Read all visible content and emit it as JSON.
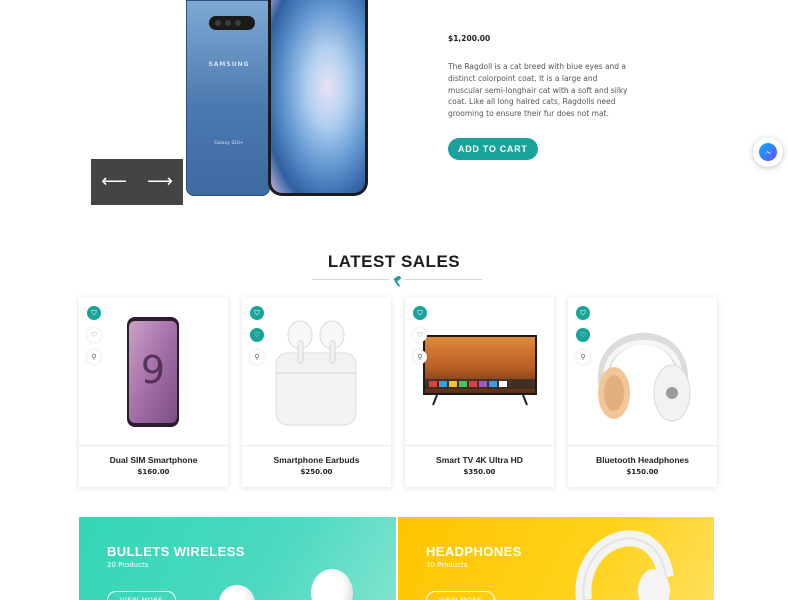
{
  "hero": {
    "price": "$1,200.00",
    "description": "The Ragdoll is a cat breed with blue eyes and a distinct colorpoint coat. It is a large and muscular semi-longhair cat with a soft and silky coat. Like all long haired cats, Ragdolls need grooming to ensure their fur does not mat.",
    "add_to_cart": "ADD TO CART",
    "phone_brand": "SAMSUNG",
    "phone_model": "Galaxy S10+",
    "prev_arrow": "⟵",
    "next_arrow": "⟶"
  },
  "section": {
    "title": "LATEST SALES"
  },
  "products": [
    {
      "name": "Dual SIM Smartphone",
      "price": "$160.00"
    },
    {
      "name": "Smartphone Earbuds",
      "price": "$250.00"
    },
    {
      "name": "Smart TV 4K Ultra HD",
      "price": "$350.00"
    },
    {
      "name": "Bluetooth Headphones",
      "price": "$150.00"
    }
  ],
  "card_actions": {
    "cart_icon": "⛉",
    "heart_icon": "♡",
    "search_icon": "⚲"
  },
  "banners": [
    {
      "title": "BULLETS WIRELESS",
      "subtitle": "20 Products",
      "button": "VIEW MORE"
    },
    {
      "title": "HEADPHONES",
      "subtitle": "30 Products",
      "button": "VIEW MORE"
    }
  ],
  "colors": {
    "accent": "#1aa39a",
    "banner_teal": "#33d6b6",
    "banner_yellow": "#ffc400",
    "slider_bg": "#444444"
  }
}
